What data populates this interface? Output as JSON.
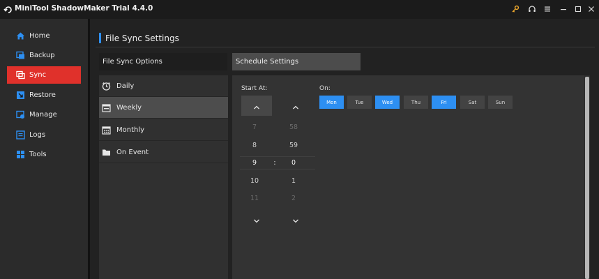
{
  "window": {
    "title": "MiniTool ShadowMaker Trial 4.4.0"
  },
  "sidebar": {
    "items": [
      {
        "label": "Home",
        "icon": "home-icon"
      },
      {
        "label": "Backup",
        "icon": "backup-icon"
      },
      {
        "label": "Sync",
        "icon": "sync-icon",
        "active": true
      },
      {
        "label": "Restore",
        "icon": "restore-icon"
      },
      {
        "label": "Manage",
        "icon": "manage-icon"
      },
      {
        "label": "Logs",
        "icon": "logs-icon"
      },
      {
        "label": "Tools",
        "icon": "tools-icon"
      }
    ]
  },
  "page": {
    "title": "File Sync Settings"
  },
  "tabs": {
    "options": "File Sync Options",
    "schedule": "Schedule Settings"
  },
  "options": {
    "items": [
      {
        "label": "Daily",
        "icon": "clock-icon"
      },
      {
        "label": "Weekly",
        "icon": "calendar-week-icon",
        "selected": true
      },
      {
        "label": "Monthly",
        "icon": "calendar-month-icon"
      },
      {
        "label": "On Event",
        "icon": "folder-icon"
      }
    ]
  },
  "schedule": {
    "start_at_label": "Start At:",
    "on_label": "On:",
    "separator": ":",
    "hours": [
      "7",
      "8",
      "9",
      "10",
      "11"
    ],
    "minutes": [
      "58",
      "59",
      "0",
      "1",
      "2"
    ],
    "days": [
      {
        "label": "Mon",
        "on": true
      },
      {
        "label": "Tue",
        "on": false
      },
      {
        "label": "Wed",
        "on": true
      },
      {
        "label": "Thu",
        "on": false
      },
      {
        "label": "Fri",
        "on": true
      },
      {
        "label": "Sat",
        "on": false
      },
      {
        "label": "Sun",
        "on": false
      }
    ]
  },
  "colors": {
    "accent_red": "#e0312b",
    "accent_blue": "#2d8ff2",
    "key_orange": "#f0a92d"
  }
}
